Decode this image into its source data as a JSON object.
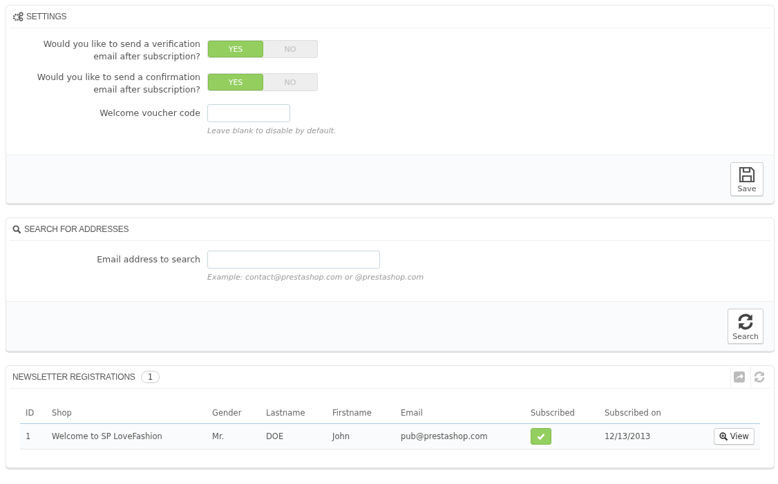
{
  "settings": {
    "title": "SETTINGS",
    "switches": [
      {
        "label": "Would you like to send a verification email after subscription?",
        "options": [
          {
            "label": "YES",
            "selected": true
          },
          {
            "label": "NO",
            "selected": false
          }
        ]
      },
      {
        "label": "Would you like to send a confirmation email after subscription?",
        "options": [
          {
            "label": "YES",
            "selected": true
          },
          {
            "label": "NO",
            "selected": false
          }
        ]
      }
    ],
    "voucher": {
      "label": "Welcome voucher code",
      "help": "Leave blank to disable by default."
    },
    "save_button": "Save"
  },
  "search": {
    "title": "SEARCH FOR ADDRESSES",
    "field": {
      "label": "Email address to search",
      "help": "Example: contact@prestashop.com or @prestashop.com"
    },
    "search_button": "Search"
  },
  "registrations": {
    "title": "NEWSLETTER REGISTRATIONS",
    "count": "1",
    "table": {
      "columns": [
        "ID",
        "Shop",
        "Gender",
        "Lastname",
        "Firstname",
        "Email",
        "Subscribed",
        "Subscribed on"
      ],
      "rows": [
        {
          "id": "1",
          "shop": "Welcome to SP LoveFashion",
          "gender": "Mr.",
          "lastname": "DOE",
          "firstname": "John",
          "email": "pub@prestashop.com",
          "subscribed": true,
          "subscribed_on": "12/13/2013",
          "action": "View"
        }
      ]
    }
  }
}
